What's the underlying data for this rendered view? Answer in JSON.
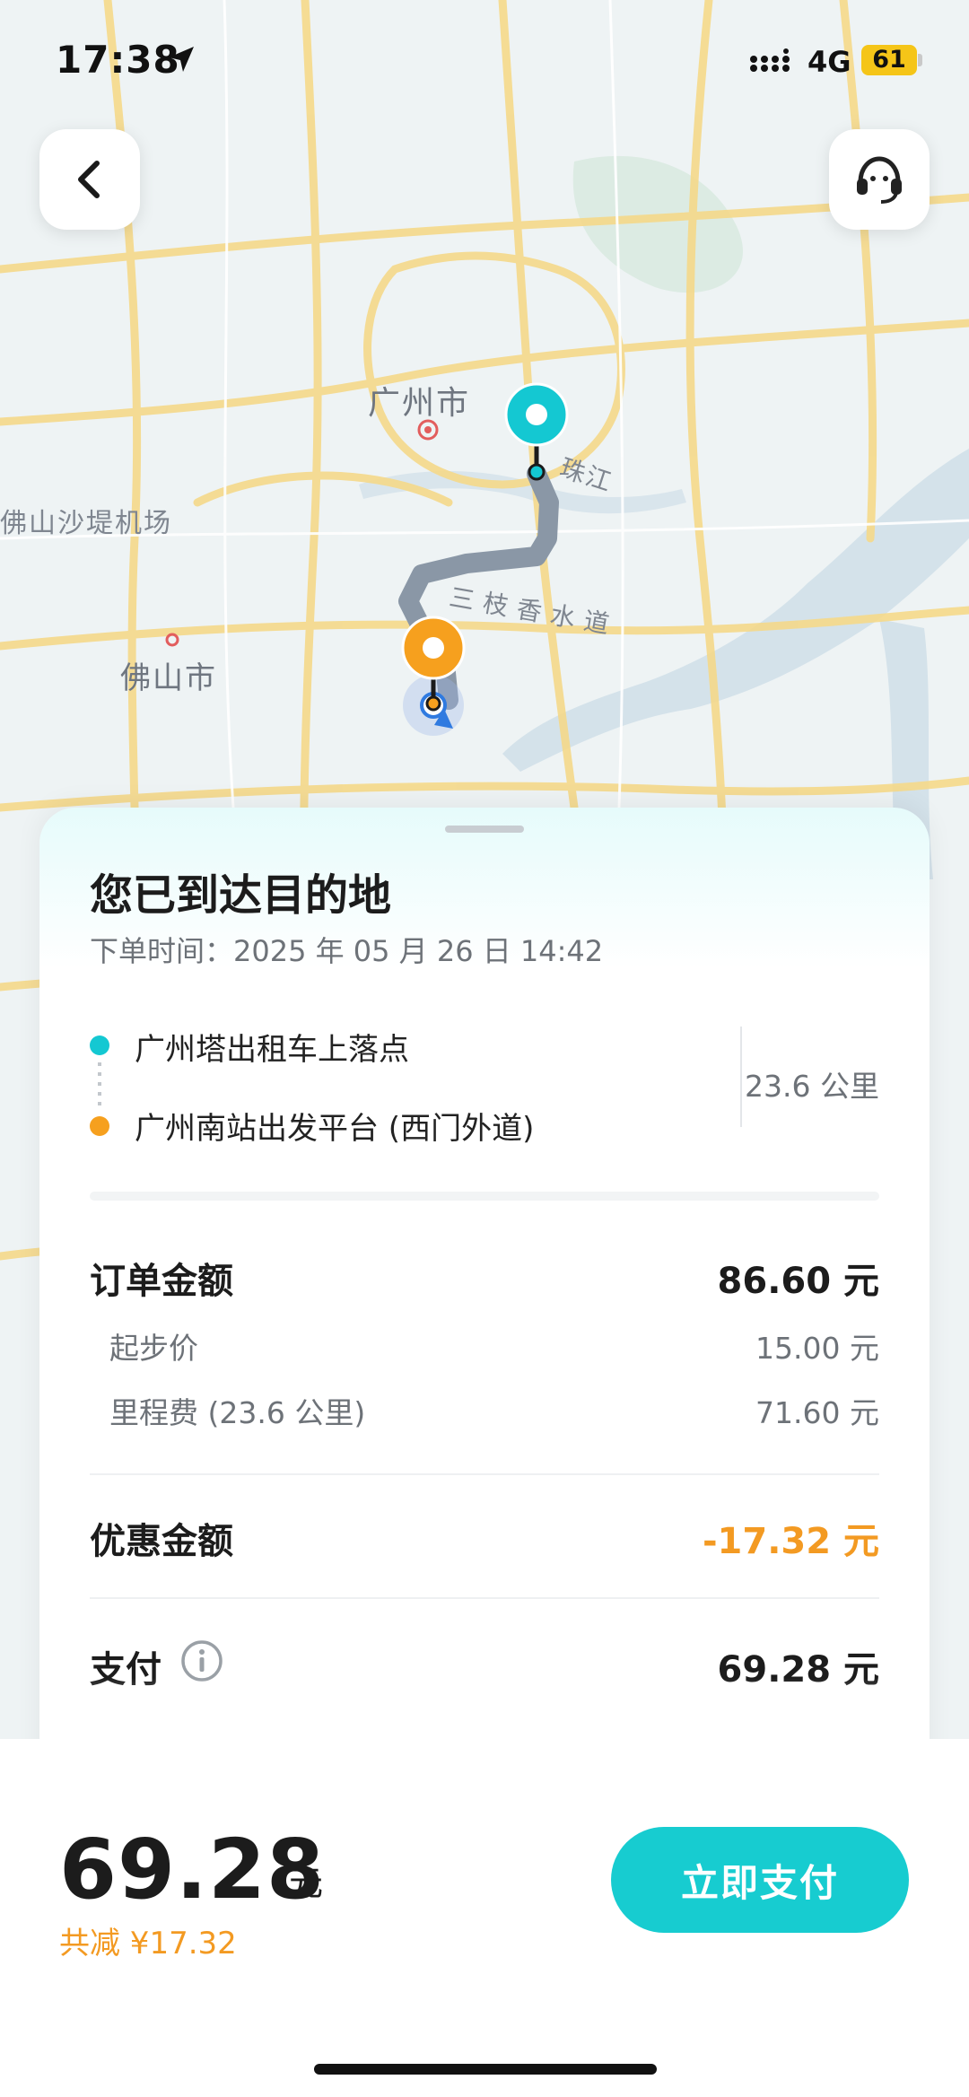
{
  "status_bar": {
    "time": "17:38",
    "network": "4G",
    "battery": "61"
  },
  "map": {
    "labels": {
      "guangzhou": "广州市",
      "foshan": "佛山市",
      "airport": "佛山沙堤机场",
      "river": "珠江",
      "canal": "三枝香水道"
    }
  },
  "trip": {
    "title": "您已到达目的地",
    "order_time": "下单时间：2025 年 05 月 26 日 14:42",
    "start": "广州塔出租车上落点",
    "end": "广州南站出发平台 (西门外道)",
    "distance": "23.6 公里"
  },
  "fare": {
    "order_amount_label": "订单金额",
    "order_amount": "86.60 元",
    "base_label": "起步价",
    "base": "15.00 元",
    "mileage_label": "里程费 (23.6 公里)",
    "mileage": "71.60 元",
    "discount_label": "优惠金额",
    "discount": "-17.32 元",
    "pay_label": "支付",
    "pay": "69.28 元"
  },
  "bottom": {
    "total": "69.28",
    "currency": "元",
    "saved": "共减 ¥17.32",
    "pay_button": "立即支付"
  },
  "colors": {
    "accent": "#17ccd0",
    "orange": "#f39a22",
    "start_dot": "#14c8d2",
    "end_dot": "#f6a01e"
  },
  "icons": {
    "back": "chevron-left-icon",
    "service": "headset-icon",
    "info": "info-icon"
  }
}
